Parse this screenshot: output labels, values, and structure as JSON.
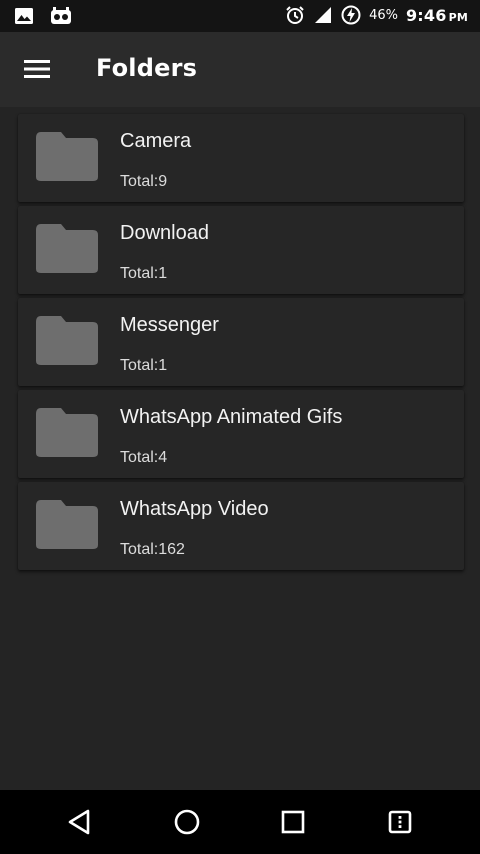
{
  "status_bar": {
    "battery_percent": "46%",
    "time": "9:46",
    "ampm": "PM",
    "icons": [
      "image-icon",
      "sim-face-icon",
      "alarm-icon",
      "signal-icon",
      "battery-charging-icon"
    ]
  },
  "app_bar": {
    "title": "Folders",
    "menu_icon": "hamburger-menu-icon"
  },
  "folders": [
    {
      "name": "Camera",
      "count_label": "Total:9"
    },
    {
      "name": "Download",
      "count_label": "Total:1"
    },
    {
      "name": "Messenger",
      "count_label": "Total:1"
    },
    {
      "name": "WhatsApp Animated Gifs",
      "count_label": "Total:4"
    },
    {
      "name": "WhatsApp Video",
      "count_label": "Total:162"
    }
  ],
  "nav_bar": {
    "buttons": [
      "back-icon",
      "home-icon",
      "recents-icon",
      "menu-icon"
    ]
  },
  "colors": {
    "background": "#242424",
    "app_bar": "#2b2b2b",
    "status_bar": "#141414",
    "folder_icon": "#6e6e6e",
    "text_primary": "#f2f2f2",
    "text_secondary": "#dcdcdc"
  }
}
